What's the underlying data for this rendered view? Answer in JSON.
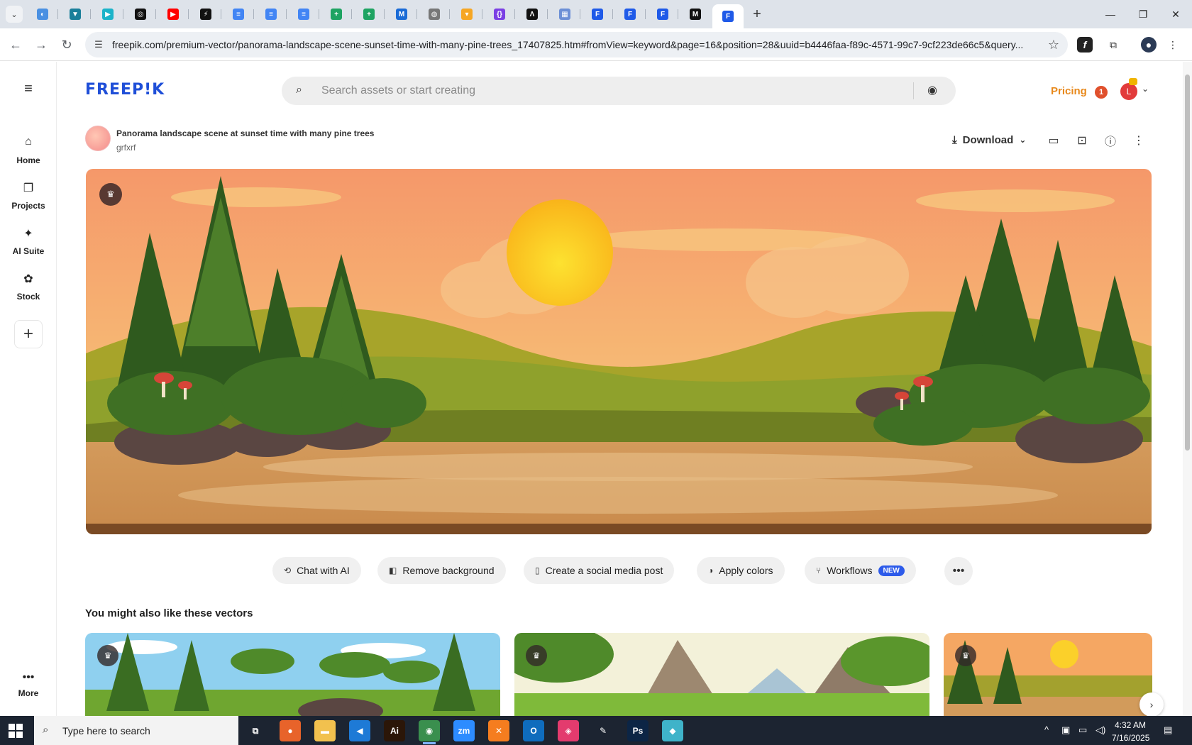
{
  "browser": {
    "url": "freepik.com/premium-vector/panorama-landscape-scene-sunset-time-with-many-pine-trees_17407825.htm#fromView=keyword&page=16&position=28&uuid=b4446faa-f89c-4571-99c7-9cf223de66c5&query...",
    "tabs": [
      {
        "icon": "globe-icon",
        "color": "#4a90e2",
        "glyph": "◐"
      },
      {
        "icon": "vpn-icon",
        "color": "#1a7f9a",
        "glyph": "▼"
      },
      {
        "icon": "app-icon",
        "color": "#1bb3c9",
        "glyph": "▶"
      },
      {
        "icon": "openai-icon",
        "color": "#111111",
        "glyph": "◎"
      },
      {
        "icon": "youtube-icon",
        "color": "#ff0000",
        "glyph": "▶"
      },
      {
        "icon": "bolt-icon",
        "color": "#111111",
        "glyph": "⚡"
      },
      {
        "icon": "docs-icon",
        "color": "#4285f4",
        "glyph": "≡"
      },
      {
        "icon": "docs-icon",
        "color": "#4285f4",
        "glyph": "≡"
      },
      {
        "icon": "docs-icon",
        "color": "#4285f4",
        "glyph": "≡"
      },
      {
        "icon": "sheets-icon",
        "color": "#1ea362",
        "glyph": "+"
      },
      {
        "icon": "sheets-icon",
        "color": "#1ea362",
        "glyph": "+"
      },
      {
        "icon": "chart-icon",
        "color": "#1a6bd6",
        "glyph": "M"
      },
      {
        "icon": "globe-icon",
        "color": "#777777",
        "glyph": "◍"
      },
      {
        "icon": "fox-icon",
        "color": "#f6a623",
        "glyph": "▾"
      },
      {
        "icon": "code-icon",
        "color": "#7b3fe4",
        "glyph": "{}"
      },
      {
        "icon": "ai-icon",
        "color": "#111111",
        "glyph": "Λ"
      },
      {
        "icon": "grid-icon",
        "color": "#6c8fd6",
        "glyph": "▦"
      },
      {
        "icon": "freepik-icon",
        "color": "#1f5ae8",
        "glyph": "F"
      },
      {
        "icon": "freepik-icon",
        "color": "#1f5ae8",
        "glyph": "F"
      },
      {
        "icon": "freepik-icon",
        "color": "#1f5ae8",
        "glyph": "F"
      },
      {
        "icon": "medium-icon",
        "color": "#111111",
        "glyph": "M"
      },
      {
        "icon": "freepik-icon",
        "color": "#1f5ae8",
        "glyph": "F"
      }
    ]
  },
  "app": {
    "logo": "FREEP!K",
    "search_placeholder": "Search assets or start creating",
    "pricing": "Pricing",
    "notifications": "1",
    "avatar_letter": "L",
    "sidebar": [
      {
        "label": "Home",
        "icon": "home-icon",
        "glyph": "⌂"
      },
      {
        "label": "Projects",
        "icon": "projects-icon",
        "glyph": "❐"
      },
      {
        "label": "AI Suite",
        "icon": "ai-suite-icon",
        "glyph": "✦"
      },
      {
        "label": "Stock",
        "icon": "stock-icon",
        "glyph": "✿"
      }
    ],
    "more_label": "More",
    "asset": {
      "title": "Panorama landscape scene at sunset time with many pine trees",
      "author": "grfxrf",
      "download": "Download"
    },
    "actions": [
      {
        "label": "Chat with AI",
        "icon": "chat-icon",
        "glyph": "⟲"
      },
      {
        "label": "Remove background",
        "icon": "remove-bg-icon",
        "glyph": "◧"
      },
      {
        "label": "Create a social media post",
        "icon": "phone-icon",
        "glyph": "▯"
      },
      {
        "label": "Apply colors",
        "icon": "palette-icon",
        "glyph": "◑"
      },
      {
        "label": "Workflows",
        "icon": "workflows-icon",
        "glyph": "⑂",
        "badge": "NEW"
      }
    ],
    "related_heading": "You might also like these vectors"
  },
  "taskbar": {
    "search_text": "Type here to search",
    "time": "4:32 AM",
    "date": "7/16/2025",
    "apps": [
      {
        "name": "task-view",
        "glyph": "⧉",
        "color": "#1c2431"
      },
      {
        "name": "firefox",
        "glyph": "●",
        "color": "#e8632a"
      },
      {
        "name": "file-explorer",
        "glyph": "▬",
        "color": "#f2c14e"
      },
      {
        "name": "vscode",
        "glyph": "◀",
        "color": "#1e7ad6"
      },
      {
        "name": "illustrator",
        "glyph": "Ai",
        "color": "#2b1608"
      },
      {
        "name": "chrome",
        "glyph": "◉",
        "color": "#3a8f4e"
      },
      {
        "name": "zoom",
        "glyph": "zm",
        "color": "#2d8cff"
      },
      {
        "name": "xampp",
        "glyph": "✕",
        "color": "#f57d1f"
      },
      {
        "name": "outlook",
        "glyph": "O",
        "color": "#0f6cbd"
      },
      {
        "name": "creative-cloud",
        "glyph": "◈",
        "color": "#e33b6e"
      },
      {
        "name": "pen-tool",
        "glyph": "✎",
        "color": "#1c2431"
      },
      {
        "name": "photoshop",
        "glyph": "Ps",
        "color": "#0c2545"
      },
      {
        "name": "app",
        "glyph": "◆",
        "color": "#3fb3c9"
      }
    ]
  }
}
